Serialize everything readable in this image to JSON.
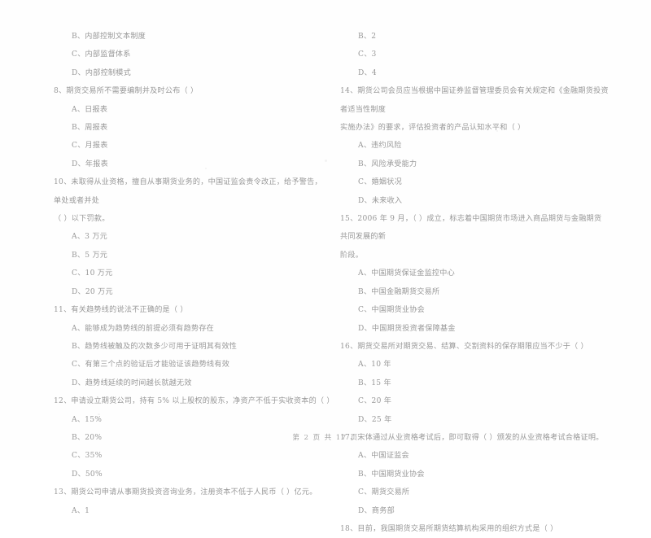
{
  "document": {
    "type": "scanned-exam-paper",
    "language": "zh-CN",
    "footer": "第 2 页  共 17 页"
  },
  "columns": {
    "left": {
      "blocks": [
        {
          "kind": "option",
          "text": "B、内部控制文本制度"
        },
        {
          "kind": "option",
          "text": "C、内部监督体系"
        },
        {
          "kind": "option",
          "text": "D、内部控制模式"
        },
        {
          "kind": "question",
          "number": "8",
          "text": "8、期货交易所不需要编制并及时公布（      ）"
        },
        {
          "kind": "option",
          "text": "A、日报表"
        },
        {
          "kind": "option",
          "text": "B、周报表"
        },
        {
          "kind": "option",
          "text": "C、月报表"
        },
        {
          "kind": "option",
          "text": "D、年报表"
        },
        {
          "kind": "question",
          "number": "10",
          "text": "10、未取得从业资格，擅自从事期货业务的，中国证监会责令改正，给予警告，单处或者并处",
          "continuation": "（      ）以下罚款。"
        },
        {
          "kind": "option",
          "text": "A、3 万元"
        },
        {
          "kind": "option",
          "text": "B、5 万元"
        },
        {
          "kind": "option",
          "text": "C、10 万元"
        },
        {
          "kind": "option",
          "text": "D、20 万元"
        },
        {
          "kind": "question",
          "number": "11",
          "text": "11、有关趋势线的说法不正确的是（      ）"
        },
        {
          "kind": "option",
          "text": "A、能够成为趋势线的前提必须有趋势存在"
        },
        {
          "kind": "option",
          "text": "B、趋势线被触及的次数多少可用于证明其有效性"
        },
        {
          "kind": "option",
          "text": "C、有第三个点的验证后才能验证该趋势线有效"
        },
        {
          "kind": "option",
          "text": "D、趋势线延续的时间越长就越无效"
        },
        {
          "kind": "question",
          "number": "12",
          "text": "12、申请设立期货公司，持有 5% 以上股权的股东，净资产不低于实收资本的（      ）"
        },
        {
          "kind": "option",
          "text": "A、15%"
        },
        {
          "kind": "option",
          "text": "B、20%"
        },
        {
          "kind": "option",
          "text": "C、35%"
        },
        {
          "kind": "option",
          "text": "D、50%"
        },
        {
          "kind": "question",
          "number": "13",
          "text": "13、期货公司申请从事期货投资咨询业务，注册资本不低于人民币（      ）亿元。"
        },
        {
          "kind": "option",
          "text": "A、1"
        }
      ]
    },
    "right": {
      "blocks": [
        {
          "kind": "option",
          "text": "B、2"
        },
        {
          "kind": "option",
          "text": "C、3"
        },
        {
          "kind": "option",
          "text": "D、4"
        },
        {
          "kind": "question",
          "number": "14",
          "text": "14、期货公司会员应当根据中国证券监督管理委员会有关规定和《金融期货投资者适当性制度",
          "continuation": "实施办法》的要求，评估投资者的产品认知水平和（      ）"
        },
        {
          "kind": "option",
          "text": "A、违约风险"
        },
        {
          "kind": "option",
          "text": "B、风险承受能力"
        },
        {
          "kind": "option",
          "text": "C、婚姻状况"
        },
        {
          "kind": "option",
          "text": "D、未来收入"
        },
        {
          "kind": "question",
          "number": "15",
          "text": "15、2006 年 9 月，（      ）成立，标志着中国期货市场进入商品期货与金融期货共同发展的新",
          "continuation": "阶段。"
        },
        {
          "kind": "option",
          "text": "A、中国期货保证金监控中心"
        },
        {
          "kind": "option",
          "text": "B、中国金融期货交易所"
        },
        {
          "kind": "option",
          "text": "C、中国期货业协会"
        },
        {
          "kind": "option",
          "text": "D、中国期货投资者保障基金"
        },
        {
          "kind": "question",
          "number": "16",
          "text": "16、期货交易所对期货交易、结算、交割资料的保存期限应当不少于（      ）"
        },
        {
          "kind": "option",
          "text": "A、10 年"
        },
        {
          "kind": "option",
          "text": "B、15 年"
        },
        {
          "kind": "option",
          "text": "C、20 年"
        },
        {
          "kind": "option",
          "text": "D、25 年"
        },
        {
          "kind": "question",
          "number": "17",
          "text": "17、宋体通过从业资格考试后，即可取得（      ）颁发的从业资格考试合格证明。"
        },
        {
          "kind": "option",
          "text": "A、中国证监会"
        },
        {
          "kind": "option",
          "text": "B、中国期货业协会"
        },
        {
          "kind": "option",
          "text": "C、期货交易所"
        },
        {
          "kind": "option",
          "text": "D、商务部"
        },
        {
          "kind": "question",
          "number": "18",
          "text": "18、目前，我国期货交易所期货结算机构采用的组织方式是（      ）"
        }
      ]
    }
  }
}
